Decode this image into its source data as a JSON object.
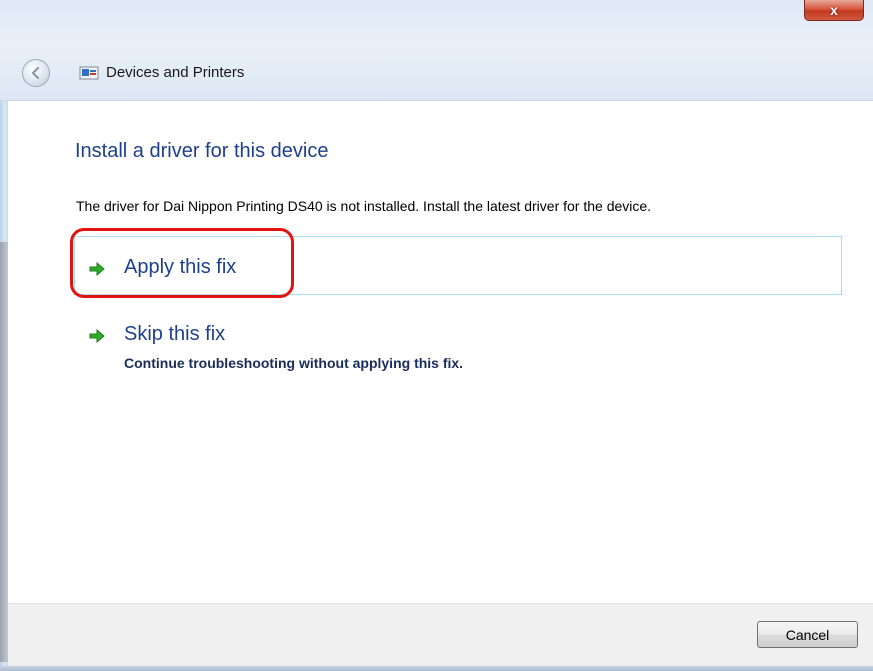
{
  "window": {
    "nav_title": "Devices and Printers",
    "close_label": "x"
  },
  "main": {
    "heading": "Install a driver for this device",
    "description": "The driver for Dai Nippon Printing DS40 is not installed. Install the latest driver for the device.",
    "options": [
      {
        "label": "Apply this fix",
        "icon": "green-arrow-icon"
      },
      {
        "label": "Skip this fix",
        "subtext": "Continue troubleshooting without applying this fix.",
        "icon": "green-arrow-icon"
      }
    ]
  },
  "footer": {
    "cancel_label": "Cancel"
  },
  "colors": {
    "heading": "#1e3f8a",
    "highlight": "#e3130f",
    "option_border": "#a8dcef",
    "close_button": "#c23a1f"
  }
}
